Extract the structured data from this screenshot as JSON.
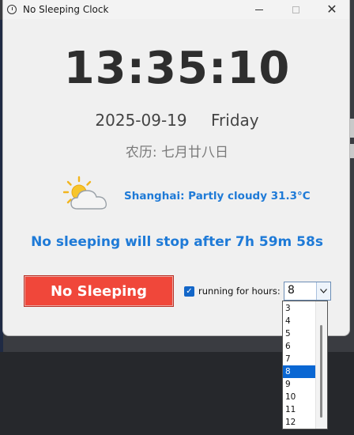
{
  "window": {
    "title": "No Sleeping Clock"
  },
  "clock": {
    "time": "13:35:10",
    "date": "2025-09-19",
    "weekday": "Friday",
    "lunar": "农历: 七月廿八日"
  },
  "weather": {
    "icon": "partly-cloudy-icon",
    "text": "Shanghai: Partly cloudy 31.3°C"
  },
  "countdown": "No sleeping will stop after 7h 59m 58s",
  "controls": {
    "button_label": "No Sleeping",
    "checkbox_checked": true,
    "checkbox_label": "running for hours:",
    "hours_value": "8",
    "hours_options": [
      "3",
      "4",
      "5",
      "6",
      "7",
      "8",
      "9",
      "10",
      "11",
      "12"
    ],
    "selected_index": 5
  },
  "colors": {
    "accent": "#1e7ad7",
    "button": "#f0473a",
    "selection": "#0a67d3"
  }
}
